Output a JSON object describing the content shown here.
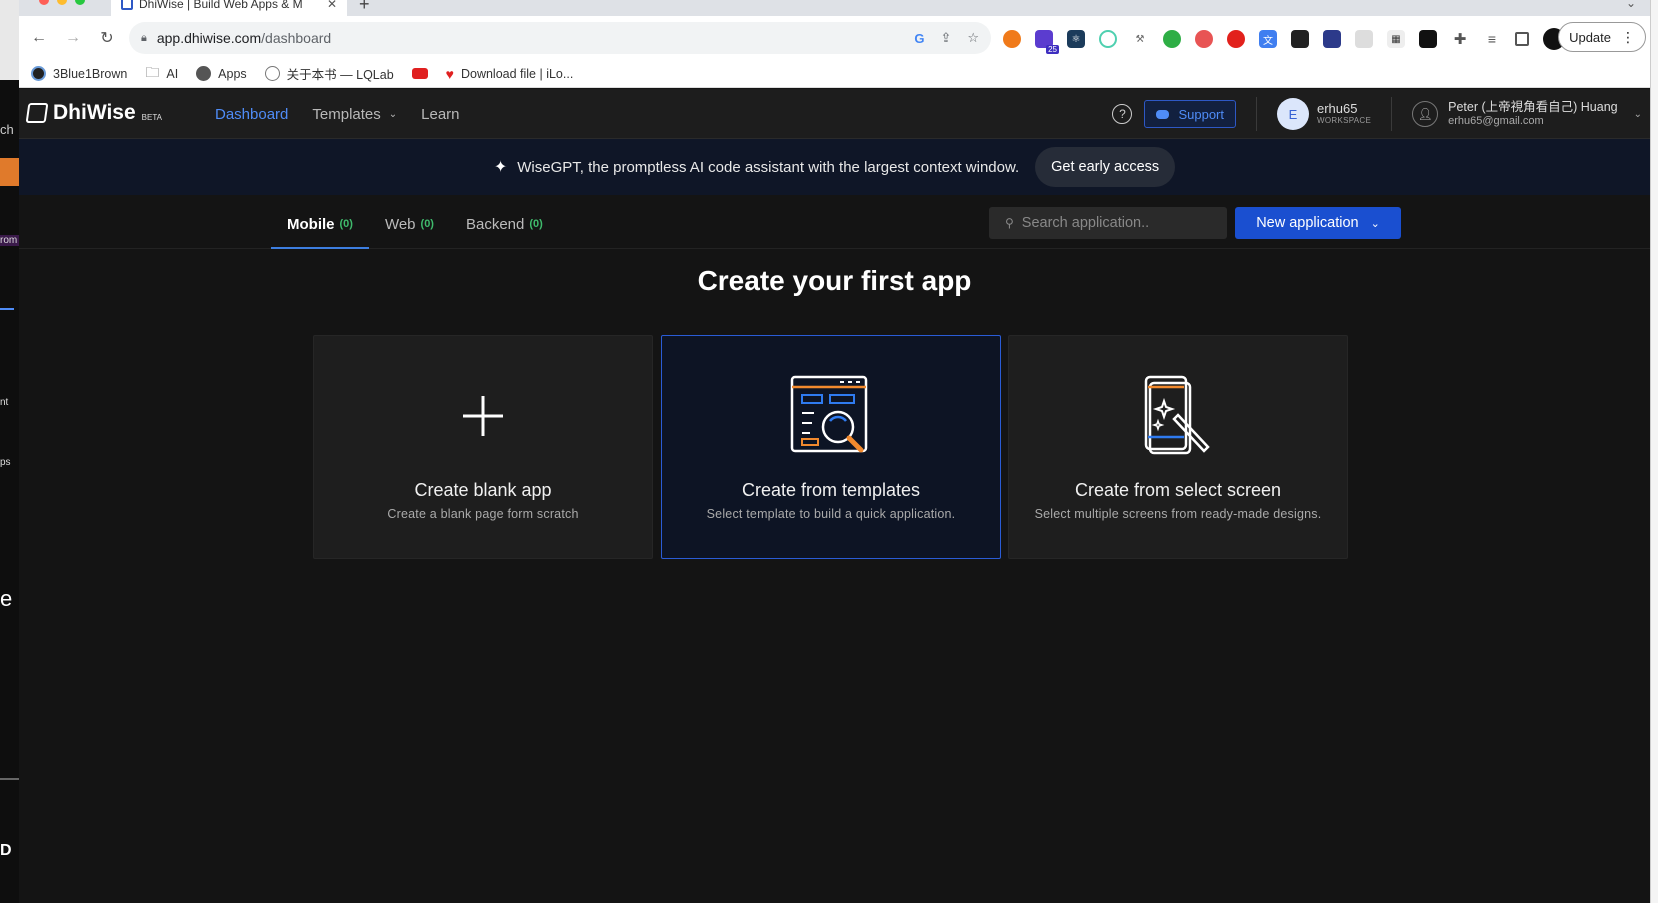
{
  "browser": {
    "tab_title": "DhiWise | Build Web Apps & M",
    "url_host": "app.dhiwise.com",
    "url_path": "/dashboard",
    "update_label": "Update",
    "extension_badge": "25",
    "bookmarks": [
      {
        "label": "3Blue1Brown",
        "icon": "3b1b-icon"
      },
      {
        "label": "AI",
        "icon": "folder-icon"
      },
      {
        "label": "Apps",
        "icon": "globe-icon"
      },
      {
        "label": "关于本书 — LQLab",
        "icon": "lqlab-icon"
      },
      {
        "label": "",
        "icon": "youtube-icon"
      },
      {
        "label": "Download file | iLo...",
        "icon": "heart-icon"
      }
    ]
  },
  "background_window_fragments": [
    "ch",
    "rom",
    "nt",
    "ps",
    "e",
    "D"
  ],
  "header": {
    "brand": "DhiWise",
    "brand_badge": "BETA",
    "nav": {
      "dashboard": "Dashboard",
      "templates": "Templates",
      "learn": "Learn"
    },
    "support_label": "Support",
    "workspace": {
      "initial": "E",
      "name": "erhu65",
      "label": "WORKSPACE"
    },
    "user": {
      "name": "Peter (上帝視角看自己) Huang",
      "email": "erhu65@gmail.com"
    }
  },
  "banner": {
    "text": "WiseGPT, the promptless AI code assistant with the largest context window.",
    "button_label": "Get early access"
  },
  "subnav": {
    "tabs": [
      {
        "label": "Mobile",
        "count": "(0)"
      },
      {
        "label": "Web",
        "count": "(0)"
      },
      {
        "label": "Backend",
        "count": "(0)"
      }
    ],
    "search_placeholder": "Search application..",
    "new_app_label": "New application"
  },
  "main": {
    "title": "Create your first app",
    "cards": [
      {
        "title": "Create blank app",
        "desc": "Create a blank page form scratch",
        "icon": "plus-icon"
      },
      {
        "title": "Create from templates",
        "desc": "Select template to build a quick application.",
        "icon": "template-search-icon"
      },
      {
        "title": "Create from select screen",
        "desc": "Select multiple screens from ready-made designs.",
        "icon": "magic-wand-phone-icon"
      }
    ]
  },
  "colors": {
    "accent": "#1a4fd0",
    "nav_active": "#4f8cf7",
    "count_green": "#3fba6c",
    "icon_orange": "#f28a2e"
  }
}
